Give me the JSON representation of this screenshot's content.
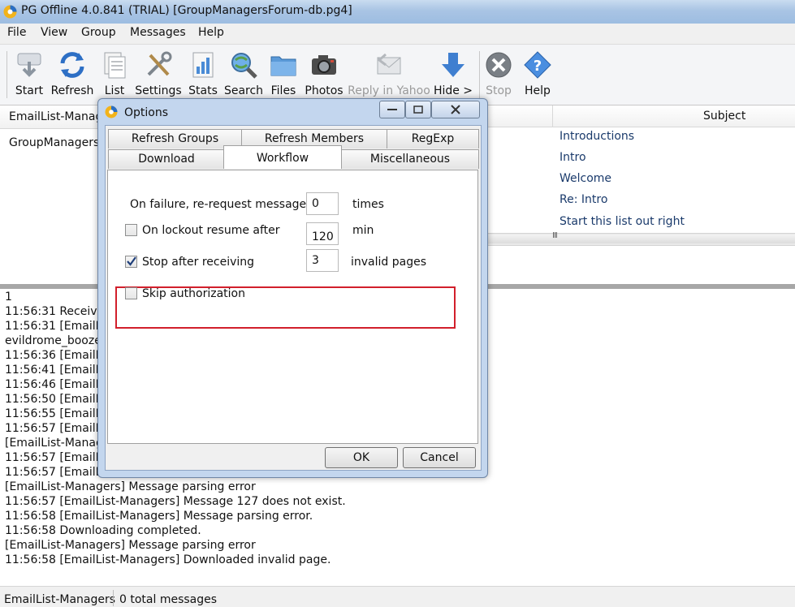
{
  "window": {
    "title": "PG Offline 4.0.841 (TRIAL) [GroupManagersForum-db.pg4]"
  },
  "menu": [
    "File",
    "View",
    "Group",
    "Messages",
    "Help"
  ],
  "toolbar": {
    "start": "Start",
    "refresh": "Refresh",
    "list": "List",
    "settings": "Settings",
    "stats": "Stats",
    "search": "Search",
    "files": "Files",
    "photos": "Photos",
    "reply": "Reply in Yahoo",
    "hide": "Hide >",
    "stop": "Stop",
    "help": "Help"
  },
  "grouplist": {
    "header": "EmailList-Managers",
    "rows": [
      "GroupManagersForum"
    ]
  },
  "msglist": {
    "header_subject": "Subject",
    "subjects": [
      "Introductions",
      "Intro",
      "Welcome",
      "Re: Intro",
      "Start this list out right"
    ],
    "scroll_grip": "III"
  },
  "log": [
    "1",
    "11:56:31 Receiving",
    "11:56:31 [EmailList",
    "evildrome_boozer",
    "11:56:36 [EmailList",
    "11:56:41 [EmailList",
    "11:56:46 [EmailList",
    "11:56:50 [EmailList",
    "11:56:55 [EmailList",
    "11:56:57 [EmailList",
    "[EmailList-Manag",
    "11:56:57 [EmailList",
    "11:56:57 [EmailList-Managers] Message parsing error.",
    "[EmailList-Managers] Message parsing error",
    "11:56:57 [EmailList-Managers] Message 127 does not exist.",
    "11:56:58 [EmailList-Managers] Message parsing error.",
    "11:56:58 Downloading completed.",
    "[EmailList-Managers] Message parsing error",
    "11:56:58 [EmailList-Managers] Downloaded invalid page."
  ],
  "statusbar": {
    "group": "EmailList-Managers",
    "count": "0 total messages"
  },
  "dialog": {
    "title": "Options",
    "tabs_row1": [
      "Refresh Groups",
      "Refresh Members",
      "RegExp"
    ],
    "tabs_row2": [
      "Download",
      "Workflow",
      "Miscellaneous"
    ],
    "active_tab": "Workflow",
    "opt_failure": {
      "label": "On failure, re-request message",
      "value": "0",
      "unit": "times"
    },
    "opt_lockout": {
      "label": "On lockout resume after",
      "value": "120",
      "unit": "min",
      "checked": false
    },
    "opt_stop": {
      "label": "Stop after receiving",
      "value": "3",
      "unit": "invalid pages",
      "checked": true
    },
    "opt_skip": {
      "label": "Skip authorization",
      "checked": false
    },
    "ok": "OK",
    "cancel": "Cancel"
  },
  "colors": {
    "highlight": "#d21f2b",
    "titlebar": "#a9c4e4",
    "link_text": "#1a3a6b"
  }
}
